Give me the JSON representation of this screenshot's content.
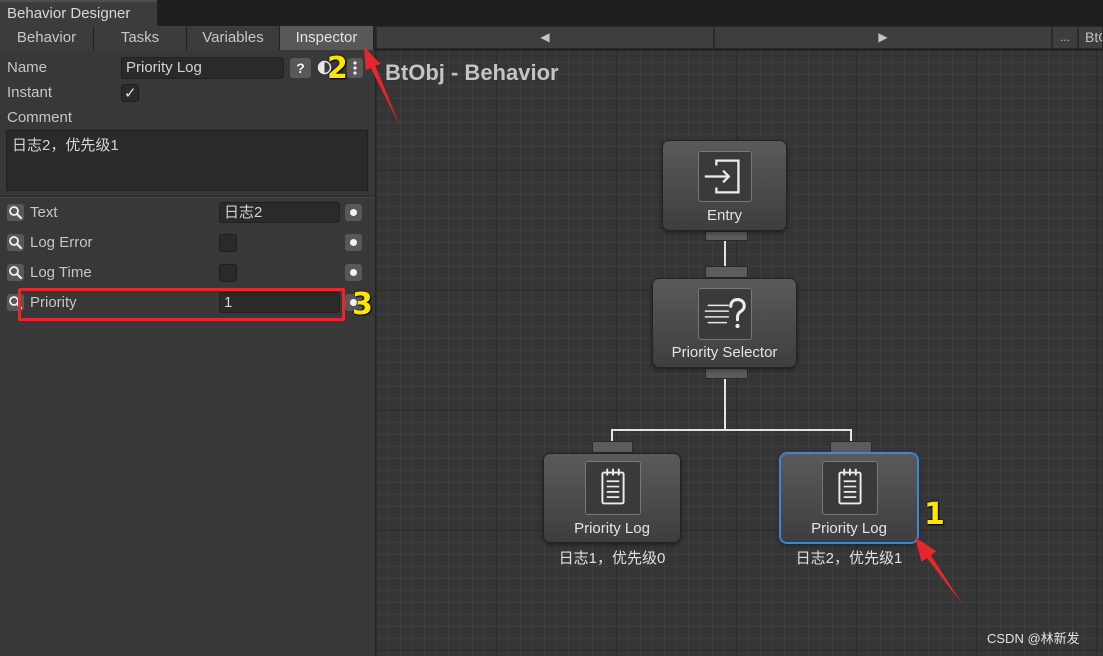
{
  "window": {
    "title": "Behavior Designer"
  },
  "tabs": [
    {
      "label": "Behavior",
      "active": false
    },
    {
      "label": "Tasks",
      "active": false
    },
    {
      "label": "Variables",
      "active": false
    },
    {
      "label": "Inspector",
      "active": true
    }
  ],
  "toolbar": {
    "prev": "◀",
    "next": "▶",
    "more": "...",
    "behavior_name": "BtO"
  },
  "inspector": {
    "name_label": "Name",
    "name_value": "Priority Log",
    "help_label": "?",
    "instant_label": "Instant",
    "instant_checked": true,
    "comment_label": "Comment",
    "comment_value": "日志2，优先级1",
    "fields": [
      {
        "label": "Text",
        "value": "日志2"
      },
      {
        "label": "Log Error",
        "checked": false
      },
      {
        "label": "Log Time",
        "checked": false
      },
      {
        "label": "Priority",
        "value": "1"
      }
    ]
  },
  "canvas": {
    "title": "BtObj - Behavior",
    "nodes": {
      "entry": {
        "label": "Entry",
        "icon": "entry-icon"
      },
      "selector": {
        "label": "Priority Selector",
        "icon": "priority-selector-icon"
      },
      "log_left": {
        "label": "Priority Log",
        "comment": "日志1，优先级0",
        "icon": "log-icon",
        "selected": false
      },
      "log_right": {
        "label": "Priority Log",
        "comment": "日志2，优先级1",
        "icon": "log-icon",
        "selected": true
      }
    }
  },
  "annotations": {
    "marker_1": "1",
    "marker_2": "2",
    "marker_3": "3"
  },
  "watermark": "CSDN @林新发",
  "colors": {
    "accent_selected": "#3e86d6",
    "marker": "#ffe600",
    "arrow": "#e8262b"
  }
}
